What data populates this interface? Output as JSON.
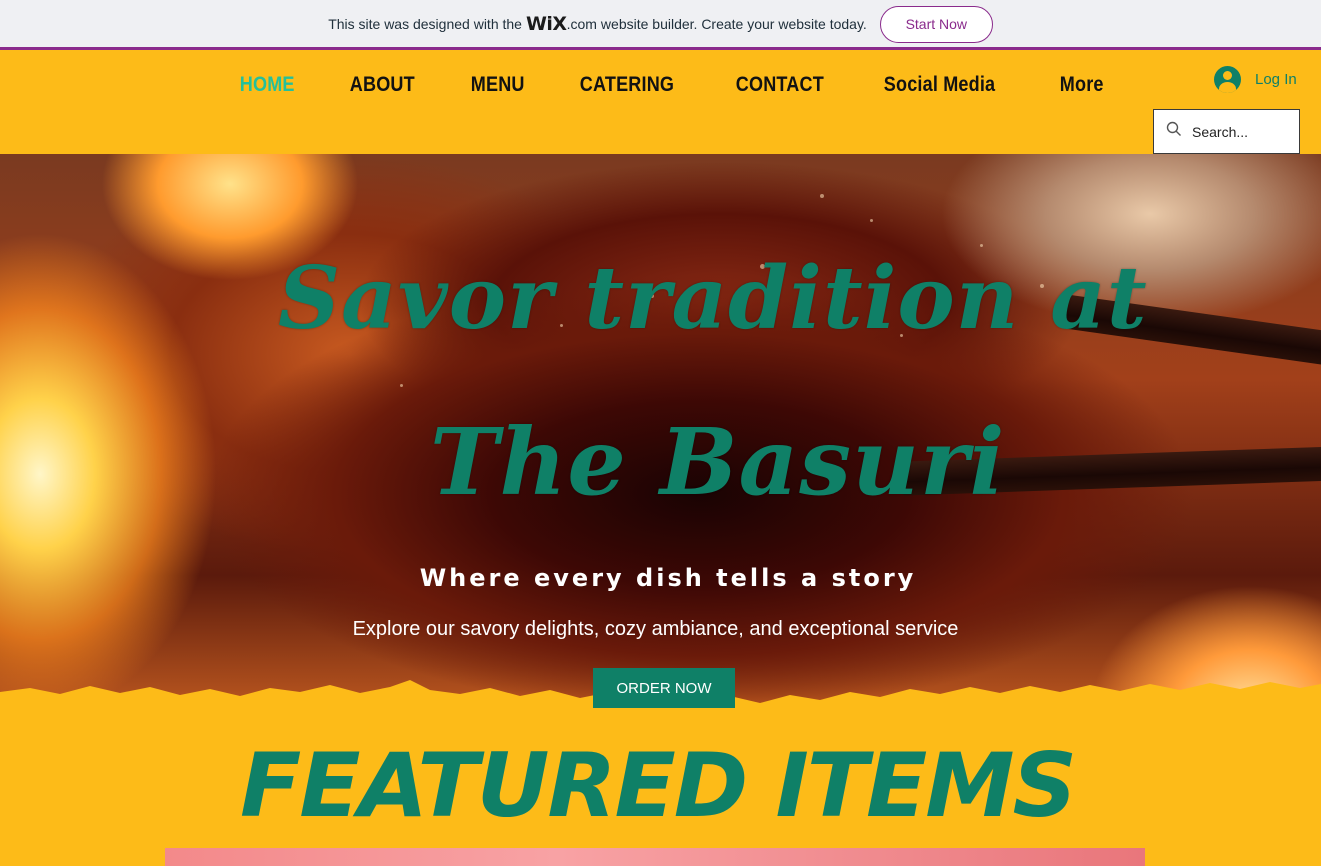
{
  "wix_banner": {
    "text_before": "This site was designed with the",
    "logo": "WiX",
    "logo_suffix": ".com",
    "text_after": "website builder. Create your website today.",
    "cta_label": "Start Now",
    "accent_color": "#8a2b8c"
  },
  "nav": {
    "items": [
      {
        "label": "HOME",
        "active": true
      },
      {
        "label": "ABOUT"
      },
      {
        "label": "MENU"
      },
      {
        "label": "CATERING"
      },
      {
        "label": "CONTACT"
      },
      {
        "label": "Social Media"
      },
      {
        "label": "More"
      }
    ]
  },
  "header": {
    "login_label": "Log In",
    "login_icon": "user-avatar-icon",
    "search_placeholder": "Search...",
    "search_icon": "search-icon",
    "background_color": "#fdbb18"
  },
  "hero": {
    "title_line_1": "Savor tradition at",
    "title_line_2": "The Basuri",
    "tagline": "Where every dish tells a story",
    "subtitle": "Explore our savory delights, cozy ambiance, and exceptional service",
    "cta_label": "ORDER NOW",
    "accent_color": "#0f8067"
  },
  "featured": {
    "title": "FEATURED ITEMS"
  }
}
